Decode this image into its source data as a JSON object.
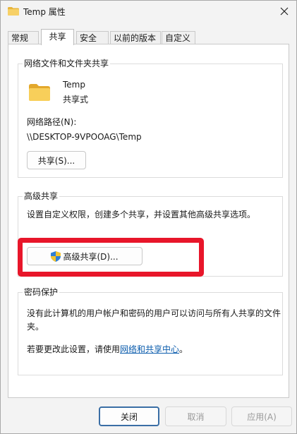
{
  "window": {
    "title": "Temp 属性",
    "close_icon": "close-icon",
    "title_icon": "folder-icon"
  },
  "tabs": [
    {
      "label": "常规",
      "active": false
    },
    {
      "label": "共享",
      "active": true
    },
    {
      "label": "安全",
      "active": false
    },
    {
      "label": "以前的版本",
      "active": false
    },
    {
      "label": "自定义",
      "active": false
    }
  ],
  "network_sharing": {
    "legend": "网络文件和文件夹共享",
    "folder_name": "Temp",
    "status": "共享式",
    "path_label": "网络路径(N):",
    "path_value": "\\\\DESKTOP-9VPOOAG\\Temp",
    "share_button": "共享(S)..."
  },
  "advanced_sharing": {
    "legend": "高级共享",
    "description": "设置自定义权限，创建多个共享，并设置其他高级共享选项。",
    "button": "高级共享(D)...",
    "button_icon": "uac-shield-icon",
    "highlight_color": "#e8162a"
  },
  "password_protection": {
    "legend": "密码保护",
    "line1": "没有此计算机的用户帐户和密码的用户可以访问与所有人共享的文件",
    "line2": "夹。",
    "change_prefix": "若要更改此设置，请使用",
    "change_link": "网络和共享中心",
    "change_suffix": "。"
  },
  "footer": {
    "close": "关闭",
    "cancel": "取消",
    "apply": "应用(A)"
  }
}
